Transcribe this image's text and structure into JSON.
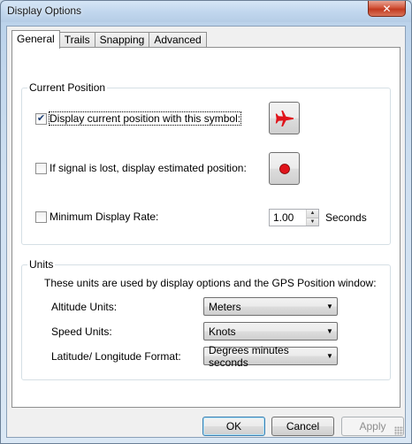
{
  "window": {
    "title": "Display Options",
    "close_glyph": "✕"
  },
  "tabs": [
    {
      "label": "General",
      "active": true
    },
    {
      "label": "Trails",
      "active": false
    },
    {
      "label": "Snapping",
      "active": false
    },
    {
      "label": "Advanced",
      "active": false
    }
  ],
  "current_position": {
    "legend": "Current Position",
    "display_symbol": {
      "label": "Display current position with this symbol:",
      "checked": true,
      "icon": "airplane-icon",
      "color": "#e0141b"
    },
    "signal_lost": {
      "label": "If signal is lost, display estimated position:",
      "checked": false,
      "icon": "red-dot-icon",
      "color": "#e0141b"
    },
    "min_rate": {
      "label": "Minimum Display Rate:",
      "checked": false,
      "value": "1.00",
      "unit": "Seconds"
    }
  },
  "units": {
    "legend": "Units",
    "description": "These units are used by display options and the GPS Position window:",
    "altitude": {
      "label": "Altitude Units:",
      "value": "Meters"
    },
    "speed": {
      "label": "Speed Units:",
      "value": "Knots"
    },
    "latlong": {
      "label": "Latitude/ Longitude Format:",
      "value": "Degrees minutes seconds"
    }
  },
  "buttons": {
    "ok": "OK",
    "cancel": "Cancel",
    "apply": "Apply"
  }
}
